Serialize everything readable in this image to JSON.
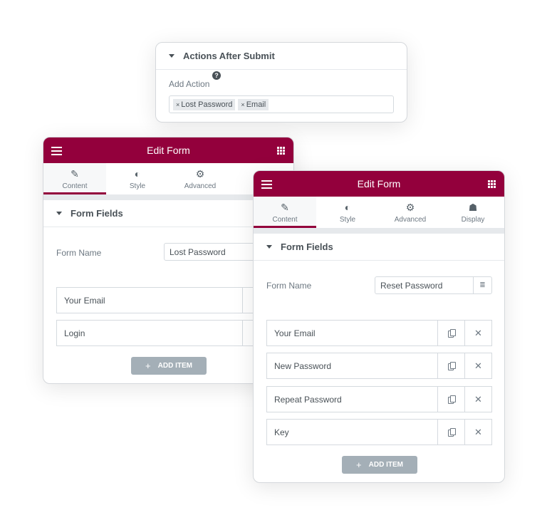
{
  "actions_card": {
    "title": "Actions After Submit",
    "add_action_label": "Add Action",
    "help_icon": "?",
    "tags": [
      "Lost Password",
      "Email"
    ],
    "tag_remove": "×"
  },
  "panel1": {
    "title": "Edit Form",
    "tabs": [
      {
        "label": "Content",
        "icon": "pencil-icon",
        "active": true
      },
      {
        "label": "Style",
        "icon": "half-circle-icon"
      },
      {
        "label": "Advanced",
        "icon": "gear-icon"
      }
    ],
    "section_title": "Form Fields",
    "form_name_label": "Form Name",
    "form_name_value": "Lost Password",
    "items": [
      "Your Email",
      "Login"
    ],
    "add_item_label": "ADD ITEM",
    "add_item_icon": "+"
  },
  "panel2": {
    "title": "Edit Form",
    "tabs": [
      {
        "label": "Content",
        "icon": "pencil-icon",
        "active": true
      },
      {
        "label": "Style",
        "icon": "half-circle-icon"
      },
      {
        "label": "Advanced",
        "icon": "gear-icon"
      },
      {
        "label": "Display",
        "icon": "ghost-icon"
      }
    ],
    "section_title": "Form Fields",
    "form_name_label": "Form Name",
    "form_name_value": "Reset Password",
    "items": [
      "Your Email",
      "New Password",
      "Repeat Password",
      "Key"
    ],
    "add_item_label": "ADD ITEM",
    "add_item_icon": "+",
    "remove_icon": "✕"
  },
  "colors": {
    "brand": "#93003c",
    "button_gray": "#a4afb7",
    "text": "#495157"
  }
}
